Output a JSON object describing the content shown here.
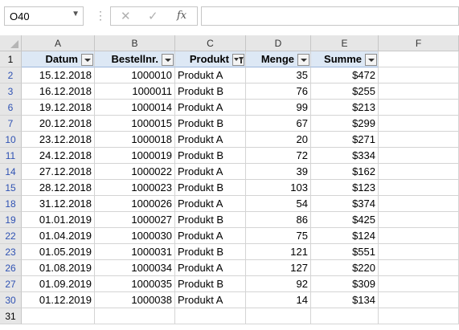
{
  "name_box": {
    "value": "O40"
  },
  "formula_bar": {
    "cancel_icon": "✕",
    "enter_icon": "✓",
    "fx_label": "fx",
    "value": ""
  },
  "columns": [
    "A",
    "B",
    "C",
    "D",
    "E",
    "F"
  ],
  "table": {
    "headers": [
      "Datum",
      "Bestellnr.",
      "Produkt",
      "Menge",
      "Summe"
    ],
    "filtered_column": "Produkt",
    "rows": [
      {
        "row": "2",
        "datum": "15.12.2018",
        "nr": "1000010",
        "produkt": "Produkt A",
        "menge": "35",
        "summe": "$472"
      },
      {
        "row": "3",
        "datum": "16.12.2018",
        "nr": "1000011",
        "produkt": "Produkt B",
        "menge": "76",
        "summe": "$255"
      },
      {
        "row": "6",
        "datum": "19.12.2018",
        "nr": "1000014",
        "produkt": "Produkt A",
        "menge": "99",
        "summe": "$213"
      },
      {
        "row": "7",
        "datum": "20.12.2018",
        "nr": "1000015",
        "produkt": "Produkt B",
        "menge": "67",
        "summe": "$299"
      },
      {
        "row": "10",
        "datum": "23.12.2018",
        "nr": "1000018",
        "produkt": "Produkt A",
        "menge": "20",
        "summe": "$271"
      },
      {
        "row": "11",
        "datum": "24.12.2018",
        "nr": "1000019",
        "produkt": "Produkt B",
        "menge": "72",
        "summe": "$334"
      },
      {
        "row": "14",
        "datum": "27.12.2018",
        "nr": "1000022",
        "produkt": "Produkt A",
        "menge": "39",
        "summe": "$162"
      },
      {
        "row": "15",
        "datum": "28.12.2018",
        "nr": "1000023",
        "produkt": "Produkt B",
        "menge": "103",
        "summe": "$123"
      },
      {
        "row": "18",
        "datum": "31.12.2018",
        "nr": "1000026",
        "produkt": "Produkt A",
        "menge": "54",
        "summe": "$374"
      },
      {
        "row": "19",
        "datum": "01.01.2019",
        "nr": "1000027",
        "produkt": "Produkt B",
        "menge": "86",
        "summe": "$425"
      },
      {
        "row": "22",
        "datum": "01.04.2019",
        "nr": "1000030",
        "produkt": "Produkt A",
        "menge": "75",
        "summe": "$124"
      },
      {
        "row": "23",
        "datum": "01.05.2019",
        "nr": "1000031",
        "produkt": "Produkt B",
        "menge": "121",
        "summe": "$551"
      },
      {
        "row": "26",
        "datum": "01.08.2019",
        "nr": "1000034",
        "produkt": "Produkt A",
        "menge": "127",
        "summe": "$220"
      },
      {
        "row": "27",
        "datum": "01.09.2019",
        "nr": "1000035",
        "produkt": "Produkt B",
        "menge": "92",
        "summe": "$309"
      },
      {
        "row": "30",
        "datum": "01.12.2019",
        "nr": "1000038",
        "produkt": "Produkt A",
        "menge": "14",
        "summe": "$134"
      }
    ]
  },
  "header_row_number": "1",
  "trailing_row_number": "31",
  "colors": {
    "header_fill": "#dde8f5",
    "filtered_row_number": "#2f52b3",
    "gridline": "#d4d4d4"
  }
}
